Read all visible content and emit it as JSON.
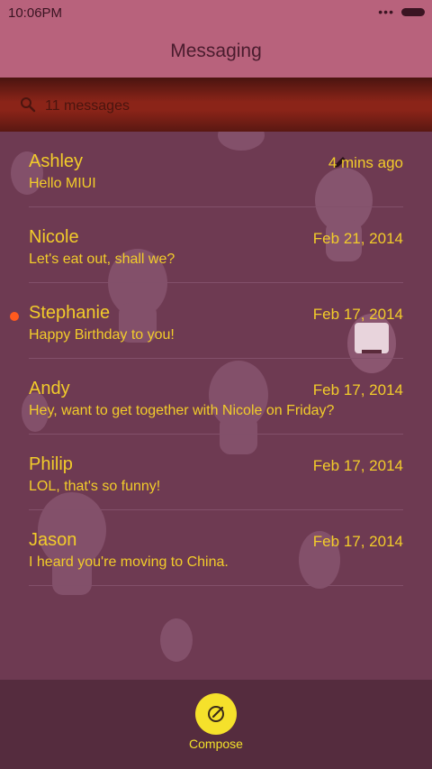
{
  "status_bar": {
    "time": "10:06PM",
    "dots": "•••"
  },
  "header": {
    "title": "Messaging"
  },
  "search": {
    "placeholder": "11 messages"
  },
  "threads": [
    {
      "name": "Ashley",
      "preview": "Hello MIUI",
      "date": "4 mins ago",
      "unread": false,
      "draft": true
    },
    {
      "name": "Nicole",
      "preview": "Let's eat out, shall we?",
      "date": "Feb 21, 2014",
      "unread": false,
      "draft": false
    },
    {
      "name": "Stephanie",
      "preview": "Happy Birthday to you!",
      "date": "Feb 17, 2014",
      "unread": true,
      "draft": false
    },
    {
      "name": "Andy",
      "preview": "Hey, want to get together with Nicole on Friday?",
      "date": "Feb 17, 2014",
      "unread": false,
      "draft": false
    },
    {
      "name": "Philip",
      "preview": "LOL, that's so funny!",
      "date": "Feb 17, 2014",
      "unread": false,
      "draft": false
    },
    {
      "name": "Jason",
      "preview": "I heard you're moving to China.",
      "date": "Feb 17, 2014",
      "unread": false,
      "draft": false
    }
  ],
  "bottom_bar": {
    "compose_label": "Compose"
  },
  "colors": {
    "accent": "#f2cc2a",
    "unread": "#ff5a1e",
    "header": "#b8627c",
    "background": "#6e3a52"
  }
}
